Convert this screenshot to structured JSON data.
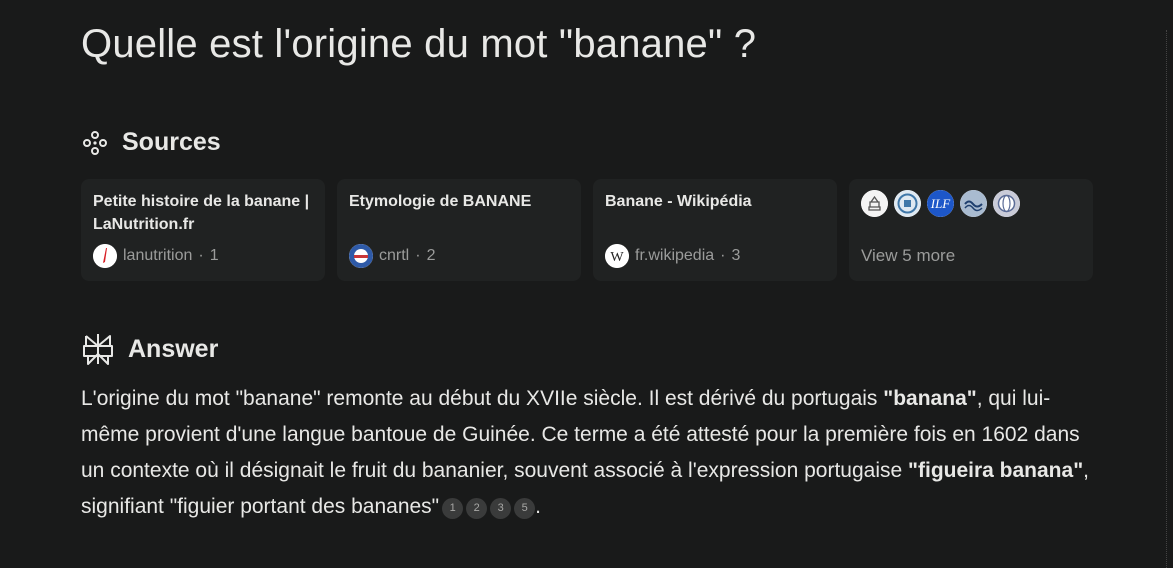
{
  "title": "Quelle est l'origine du mot \"banane\" ?",
  "sources": {
    "heading": "Sources",
    "cards": [
      {
        "title": "Petite histoire de la banane | LaNutrition.fr",
        "site": "lanutrition",
        "index": "1"
      },
      {
        "title": "Etymologie de BANANE",
        "site": "cnrtl",
        "index": "2"
      },
      {
        "title": "Banane - Wikipédia",
        "site": "fr.wikipedia",
        "index": "3"
      }
    ],
    "more_label": "View 5 more"
  },
  "answer": {
    "heading": "Answer",
    "p1": "L'origine du mot \"banane\" remonte au début du XVIIe siècle. Il est dérivé du portugais",
    "bold1": "\"banana\"",
    "p2": ", qui lui-même provient d'une langue bantoue de Guinée. Ce terme a été attesté pour la première fois en 1602 dans un contexte où il désignait le fruit du bananier, souvent associé à l'expression portugaise ",
    "bold2": "\"figueira banana\"",
    "p3": ", signifiant \"figuier portant des bananes\"",
    "citations": [
      "1",
      "2",
      "3",
      "5"
    ],
    "end": "."
  },
  "colors": {
    "background": "#191a1a",
    "card": "#202222",
    "text": "#e8e8e6",
    "muted": "#9b9c9b"
  }
}
